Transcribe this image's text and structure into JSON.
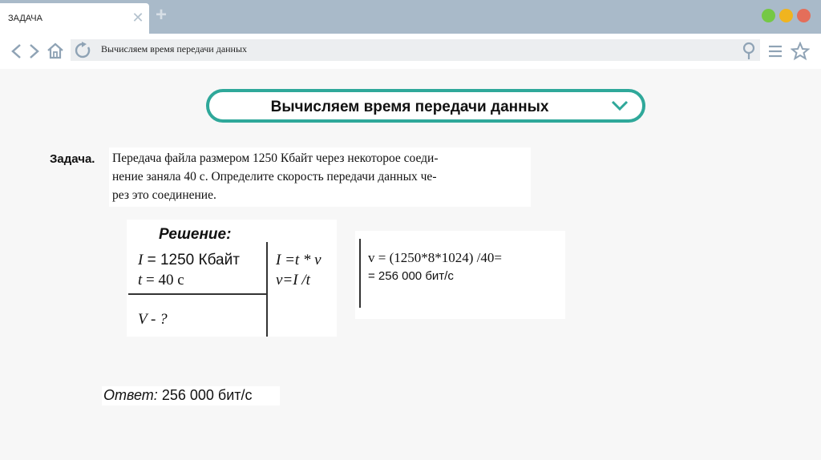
{
  "browser": {
    "tab_title": "ЗАДАЧА",
    "tab_close_glyph": "✕",
    "new_tab_glyph": "+",
    "address": "Вычисляем время передачи данных",
    "colors": {
      "titlebar": "#a9bac9",
      "accent": "#2fa89a",
      "dot_green": "#75c846",
      "dot_yellow": "#f0b41f",
      "dot_red": "#e46e5a"
    }
  },
  "header": {
    "title": "Вычисляем время передачи данных"
  },
  "task": {
    "label": "Задача.",
    "lines": [
      "Передача файла размером 1250 Кбайт через некоторое соеди-",
      "нение заняла 40 с. Определите скорость передачи данных че-",
      "рез это соединение."
    ]
  },
  "solution": {
    "title": "Решение:",
    "given_1_var": "I",
    "given_1_value": " = 1250  Кбайт",
    "given_2_var": "t",
    "given_2_value": " = 40 с",
    "formula_1": "I =t * v",
    "formula_2": "v=I /t",
    "find": "V  - ?"
  },
  "calculation": {
    "line_1": "v = (1250*8*1024) /40=",
    "line_2": "= 256 000 бит/с"
  },
  "answer": {
    "label": "Ответ:",
    "value": " 256 000 бит/с"
  }
}
